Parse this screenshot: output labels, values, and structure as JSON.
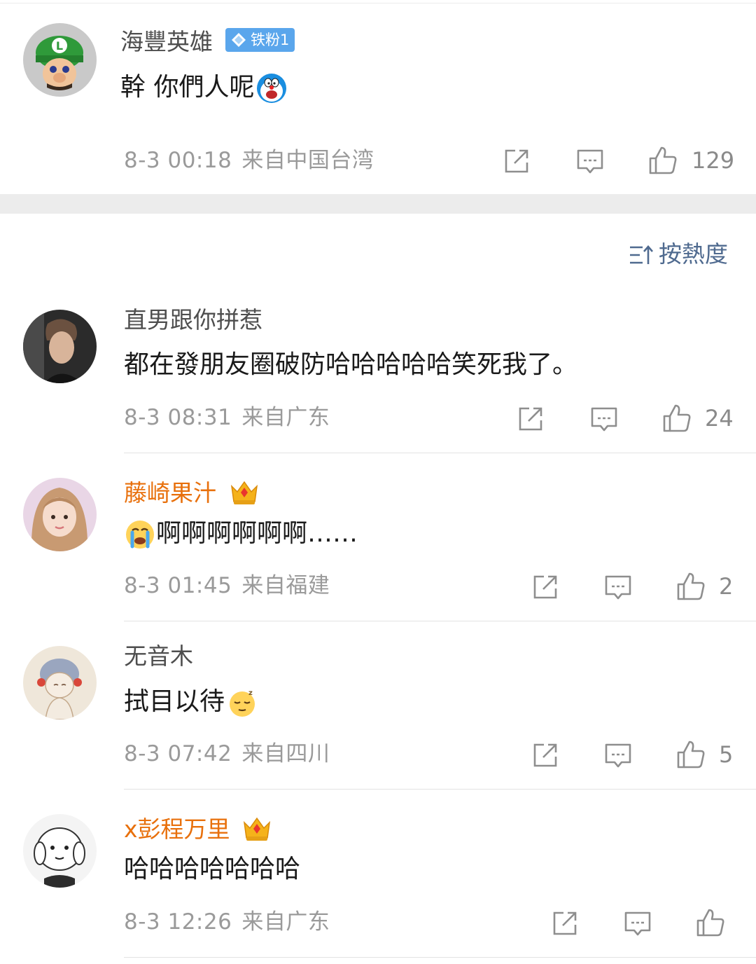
{
  "sort": {
    "label": "按熱度"
  },
  "comments": [
    {
      "username": "海豐英雄",
      "badge": "铁粉1",
      "content": "幹 你們人呢",
      "emoji": "doraemon-emoji",
      "time": "8-3 00:18",
      "location": "来自中国台湾",
      "likes": "129"
    },
    {
      "username": "直男跟你拼惹",
      "content": "都在發朋友圈破防哈哈哈哈哈笑死我了。",
      "time": "8-3 08:31",
      "location": "来自广东",
      "likes": "24"
    },
    {
      "username": "藤崎果汁",
      "content_prefix_emoji": "crying-emoji",
      "content": "啊啊啊啊啊啊……",
      "time": "8-3 01:45",
      "location": "来自福建",
      "likes": "2"
    },
    {
      "username": "无音木",
      "content": "拭目以待",
      "emoji": "sleepy-emoji",
      "time": "8-3 07:42",
      "location": "来自四川",
      "likes": "5"
    },
    {
      "username": "x彭程万里",
      "content": "哈哈哈哈哈哈哈",
      "time": "8-3 12:26",
      "location": "来自广东",
      "likes": ""
    }
  ],
  "colors": {
    "vip_name": "#e8700c",
    "badge_bg": "#5aa6ec",
    "sort_text": "#4f6a8f"
  }
}
